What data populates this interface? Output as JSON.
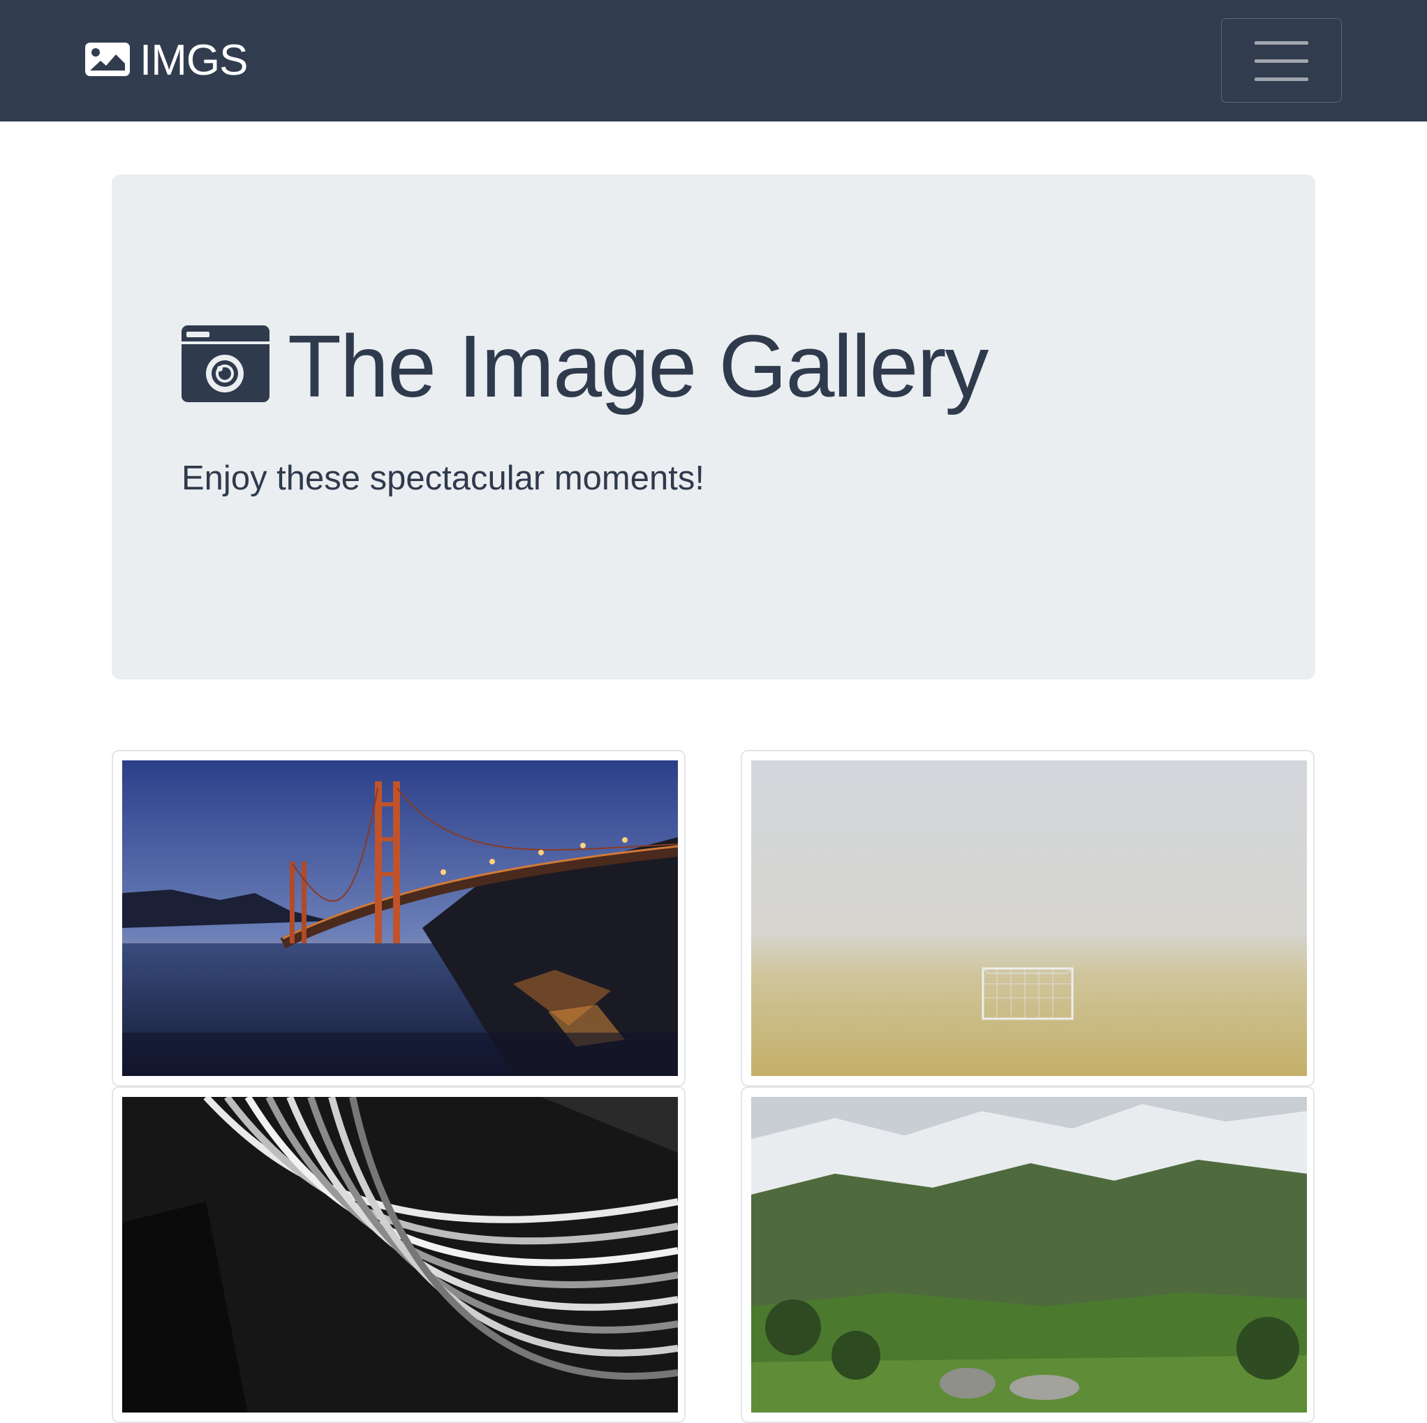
{
  "navbar": {
    "brand_text": "IMGS",
    "brand_icon": "image-icon",
    "menu_icon": "hamburger-menu-icon"
  },
  "hero": {
    "title": "The Image Gallery",
    "title_icon": "camera-icon",
    "subtitle": "Enjoy these spectacular moments!"
  },
  "gallery": {
    "items": [
      {
        "subject": "golden-gate-bridge-at-dusk"
      },
      {
        "subject": "foggy-field-with-goal"
      },
      {
        "subject": "abstract-architecture-bw"
      },
      {
        "subject": "snowy-mountains-green-valley"
      }
    ]
  },
  "colors": {
    "navbar_bg": "#313c4f",
    "hero_bg": "#ebeef0",
    "text_dark": "#2f3a4d"
  }
}
